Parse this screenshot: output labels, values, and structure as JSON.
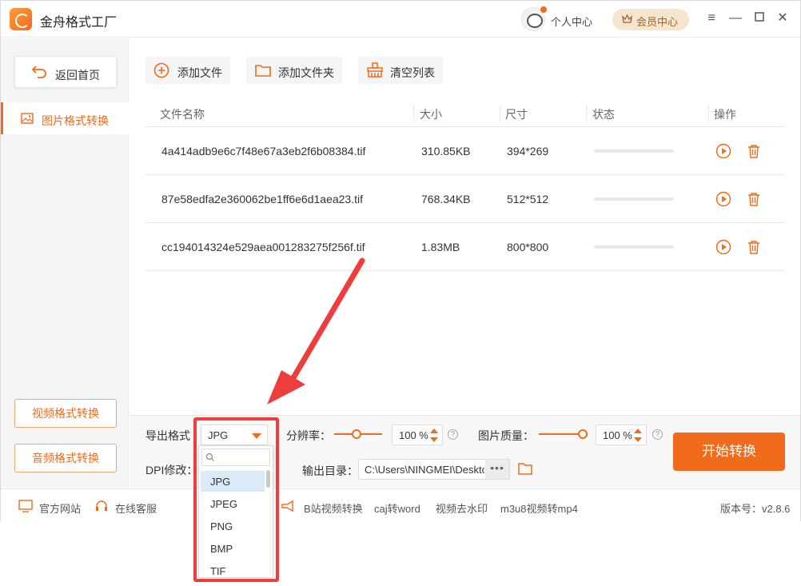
{
  "window": {
    "app_title": "金舟格式工厂",
    "user_center": "个人中心",
    "vip_center": "会员中心"
  },
  "sidebar": {
    "back_home": "返回首页",
    "active_item": "图片格式转换",
    "video_convert": "视频格式转换",
    "audio_convert": "音频格式转换"
  },
  "toolbar": {
    "add_file": "添加文件",
    "add_folder": "添加文件夹",
    "clear_list": "清空列表"
  },
  "table": {
    "headers": [
      "文件名称",
      "大小",
      "尺寸",
      "状态",
      "操作"
    ],
    "rows": [
      {
        "name": "4a414adb9e6c7f48e67a3eb2f6b08384.tif",
        "size": "310.85KB",
        "dims": "394*269",
        "progress": 0
      },
      {
        "name": "87e58edfa2e360062be1ff6e6d1aea23.tif",
        "size": "768.34KB",
        "dims": "512*512",
        "progress": 0
      },
      {
        "name": "cc194014324e529aea001283275f256f.tif",
        "size": "1.83MB",
        "dims": "800*800",
        "progress": 0
      }
    ]
  },
  "settings": {
    "export_format_label": "导出格式",
    "export_format_value": "JPG",
    "resolution_label": "分辨率：",
    "resolution_value": "100 %",
    "quality_label": "图片质量：",
    "quality_value": "100 %",
    "dpi_label": "DPI修改：",
    "output_dir_label": "输出目录：",
    "output_dir_value": "C:\\Users\\NINGMEI\\Deskto",
    "output_dir_more": "•••",
    "start_button": "开始转换"
  },
  "dropdown": {
    "search_placeholder": "",
    "options": [
      "JPG",
      "JPEG",
      "PNG",
      "BMP",
      "TIF"
    ],
    "selected": "JPG"
  },
  "statusbar": {
    "website": "官方网站",
    "online_service": "在线客服",
    "links": [
      "B站视频转换",
      "caj转word",
      "视频去水印",
      "m3u8视频转mp4"
    ],
    "version": "版本号：v2.8.6"
  },
  "colors": {
    "accent": "#f26a1b",
    "annotation": "#ee3d3d",
    "vip_bg": "#f5e5cf"
  }
}
